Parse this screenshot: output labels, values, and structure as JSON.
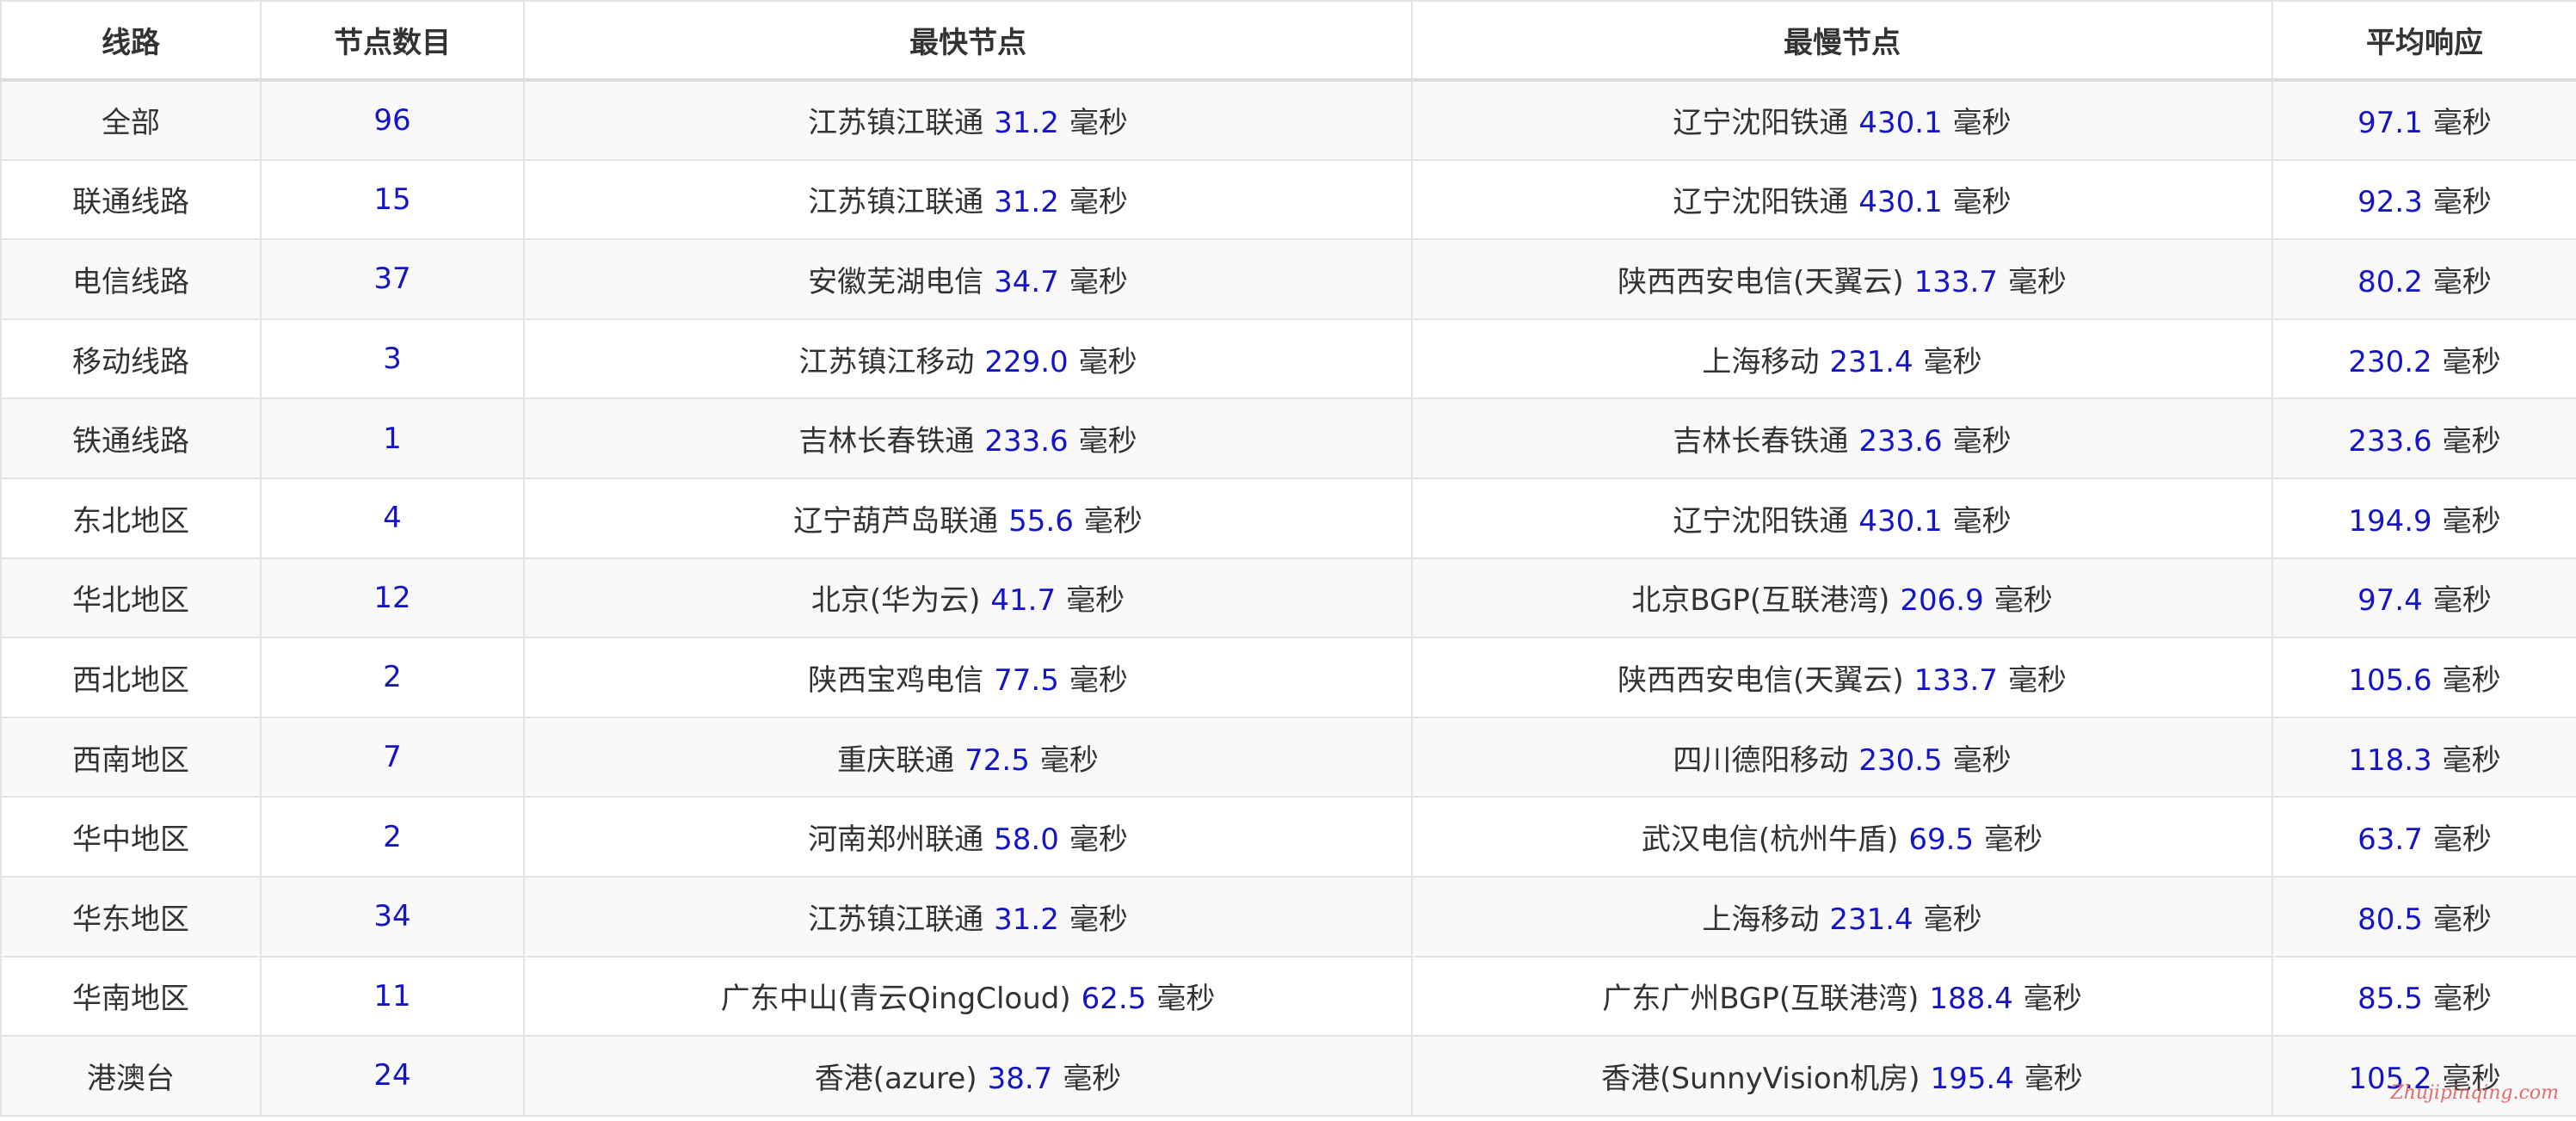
{
  "table": {
    "headers": {
      "route": "线路",
      "node_count": "节点数目",
      "fastest": "最快节点",
      "slowest": "最慢节点",
      "average": "平均响应"
    },
    "unit": "毫秒",
    "rows": [
      {
        "route": "全部",
        "count": "96",
        "fast_name": "江苏镇江联通",
        "fast_ms": "31.2",
        "slow_name": "辽宁沈阳铁通",
        "slow_ms": "430.1",
        "avg_ms": "97.1"
      },
      {
        "route": "联通线路",
        "count": "15",
        "fast_name": "江苏镇江联通",
        "fast_ms": "31.2",
        "slow_name": "辽宁沈阳铁通",
        "slow_ms": "430.1",
        "avg_ms": "92.3"
      },
      {
        "route": "电信线路",
        "count": "37",
        "fast_name": "安徽芜湖电信",
        "fast_ms": "34.7",
        "slow_name": "陕西西安电信(天翼云)",
        "slow_ms": "133.7",
        "avg_ms": "80.2"
      },
      {
        "route": "移动线路",
        "count": "3",
        "fast_name": "江苏镇江移动",
        "fast_ms": "229.0",
        "slow_name": "上海移动",
        "slow_ms": "231.4",
        "avg_ms": "230.2"
      },
      {
        "route": "铁通线路",
        "count": "1",
        "fast_name": "吉林长春铁通",
        "fast_ms": "233.6",
        "slow_name": "吉林长春铁通",
        "slow_ms": "233.6",
        "avg_ms": "233.6"
      },
      {
        "route": "东北地区",
        "count": "4",
        "fast_name": "辽宁葫芦岛联通",
        "fast_ms": "55.6",
        "slow_name": "辽宁沈阳铁通",
        "slow_ms": "430.1",
        "avg_ms": "194.9"
      },
      {
        "route": "华北地区",
        "count": "12",
        "fast_name": "北京(华为云)",
        "fast_ms": "41.7",
        "slow_name": "北京BGP(互联港湾)",
        "slow_ms": "206.9",
        "avg_ms": "97.4"
      },
      {
        "route": "西北地区",
        "count": "2",
        "fast_name": "陕西宝鸡电信",
        "fast_ms": "77.5",
        "slow_name": "陕西西安电信(天翼云)",
        "slow_ms": "133.7",
        "avg_ms": "105.6"
      },
      {
        "route": "西南地区",
        "count": "7",
        "fast_name": "重庆联通",
        "fast_ms": "72.5",
        "slow_name": "四川德阳移动",
        "slow_ms": "230.5",
        "avg_ms": "118.3"
      },
      {
        "route": "华中地区",
        "count": "2",
        "fast_name": "河南郑州联通",
        "fast_ms": "58.0",
        "slow_name": "武汉电信(杭州牛盾)",
        "slow_ms": "69.5",
        "avg_ms": "63.7"
      },
      {
        "route": "华东地区",
        "count": "34",
        "fast_name": "江苏镇江联通",
        "fast_ms": "31.2",
        "slow_name": "上海移动",
        "slow_ms": "231.4",
        "avg_ms": "80.5"
      },
      {
        "route": "华南地区",
        "count": "11",
        "fast_name": "广东中山(青云QingCloud)",
        "fast_ms": "62.5",
        "slow_name": "广东广州BGP(互联港湾)",
        "slow_ms": "188.4",
        "avg_ms": "85.5"
      },
      {
        "route": "港澳台",
        "count": "24",
        "fast_name": "香港(azure)",
        "fast_ms": "38.7",
        "slow_name": "香港(SunnyVision机房)",
        "slow_ms": "195.4",
        "avg_ms": "105.2"
      }
    ]
  },
  "watermark": "Zhujipinqing.com",
  "colors": {
    "value_blue": "#1515c8",
    "text": "#333333",
    "border": "#e4e4e4",
    "stripe": "#f9f9f9",
    "watermark": "#e65050"
  }
}
